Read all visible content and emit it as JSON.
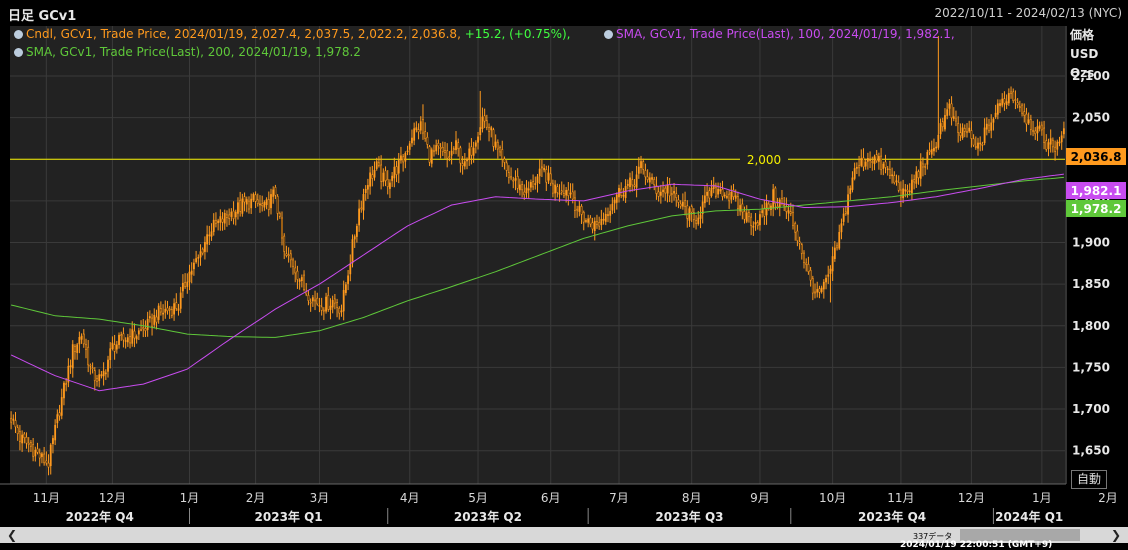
{
  "header": {
    "title": "日足 GCv1",
    "date_range": "2022/10/11 - 2024/02/13 (NYC)"
  },
  "legend": {
    "candle_text": "Cndl, GCv1, Trade Price, 2024/01/19, 2,027.4, 2,037.5, 2,022.2, 2,036.8,",
    "change_text": "+15.2, (+0.75%),",
    "sma100_text": "SMA, GCv1, Trade Price(Last),  100, 2024/01/19, 1,982.1,",
    "sma200_text": "SMA, GCv1, Trade Price(Last),  200, 2024/01/19, 1,978.2"
  },
  "axis_unit": {
    "line1": "価格",
    "line2": "USD",
    "line3": "Ozs"
  },
  "auto_button": "自動",
  "status": {
    "count": "337データ",
    "timestamp": "2024/01/19 22:00:51 (GMT+9)"
  },
  "colors": {
    "candle": "#ff9a1e",
    "sma100": "#c84cf0",
    "sma200": "#5fc83a",
    "reference": "#f5f000",
    "grid": "#3a3a3a",
    "background": "#222222",
    "change": "#40ff40"
  },
  "icons": {
    "scroll_left": "scroll-left-icon",
    "scroll_right": "scroll-right-icon",
    "legend_dot": "legend-dot-icon"
  },
  "chart_data": {
    "type": "candlestick",
    "title": "日足 GCv1",
    "ylim": [
      1610,
      2160
    ],
    "y_ticks": [
      "1,650",
      "1,700",
      "1,750",
      "1,800",
      "1,850",
      "1,900",
      "1,950",
      "2,000",
      "2,050",
      "2,100"
    ],
    "y_tick_values": [
      1650,
      1700,
      1750,
      1800,
      1850,
      1900,
      1950,
      2000,
      2050,
      2100
    ],
    "x_month_ticks": [
      "11月",
      "12月",
      "1月",
      "2月",
      "3月",
      "4月",
      "5月",
      "6月",
      "7月",
      "8月",
      "9月",
      "10月",
      "11月",
      "12月",
      "1月",
      "2月"
    ],
    "x_quarter_labels": [
      "2022年 Q4",
      "2023年 Q1",
      "2023年 Q2",
      "2023年 Q3",
      "2023年 Q4",
      "2024年 Q1"
    ],
    "reference_line": {
      "value": 2000,
      "label": "2,000"
    },
    "last_price_labels": [
      {
        "text": "2,036.8",
        "value": 2036.8,
        "series": "candle"
      },
      {
        "text": "1,982.1",
        "value": 1982.1,
        "series": "sma100"
      },
      {
        "text": "1,978.2",
        "value": 1978.2,
        "series": "sma200"
      }
    ],
    "candle_anchor_points": [
      [
        0,
        1690
      ],
      [
        4,
        1665
      ],
      [
        9,
        1655
      ],
      [
        14,
        1640
      ],
      [
        17,
        1635
      ],
      [
        22,
        1700
      ],
      [
        28,
        1770
      ],
      [
        32,
        1790
      ],
      [
        37,
        1740
      ],
      [
        41,
        1735
      ],
      [
        46,
        1775
      ],
      [
        52,
        1785
      ],
      [
        57,
        1790
      ],
      [
        62,
        1800
      ],
      [
        67,
        1815
      ],
      [
        72,
        1820
      ],
      [
        76,
        1825
      ],
      [
        80,
        1860
      ],
      [
        85,
        1880
      ],
      [
        90,
        1915
      ],
      [
        95,
        1925
      ],
      [
        100,
        1935
      ],
      [
        105,
        1945
      ],
      [
        110,
        1950
      ],
      [
        115,
        1940
      ],
      [
        120,
        1960
      ],
      [
        124,
        1885
      ],
      [
        128,
        1875
      ],
      [
        133,
        1845
      ],
      [
        138,
        1830
      ],
      [
        142,
        1825
      ],
      [
        146,
        1830
      ],
      [
        150,
        1820
      ],
      [
        154,
        1880
      ],
      [
        158,
        1940
      ],
      [
        162,
        1975
      ],
      [
        166,
        1990
      ],
      [
        170,
        1970
      ],
      [
        174,
        1985
      ],
      [
        178,
        2000
      ],
      [
        182,
        2030
      ],
      [
        186,
        2040
      ],
      [
        190,
        2005
      ],
      [
        194,
        2010
      ],
      [
        198,
        2000
      ],
      [
        202,
        2015
      ],
      [
        206,
        1990
      ],
      [
        210,
        2020
      ],
      [
        214,
        2050
      ],
      [
        218,
        2030
      ],
      [
        222,
        2000
      ],
      [
        226,
        1980
      ],
      [
        230,
        1970
      ],
      [
        234,
        1960
      ],
      [
        238,
        1975
      ],
      [
        242,
        1985
      ],
      [
        246,
        1965
      ],
      [
        250,
        1965
      ],
      [
        254,
        1960
      ],
      [
        258,
        1935
      ],
      [
        262,
        1925
      ],
      [
        266,
        1920
      ],
      [
        270,
        1935
      ],
      [
        274,
        1955
      ],
      [
        278,
        1965
      ],
      [
        282,
        1970
      ],
      [
        286,
        1990
      ],
      [
        290,
        1975
      ],
      [
        294,
        1960
      ],
      [
        298,
        1965
      ],
      [
        302,
        1950
      ],
      [
        306,
        1940
      ],
      [
        310,
        1925
      ],
      [
        314,
        1945
      ],
      [
        318,
        1960
      ],
      [
        322,
        1965
      ],
      [
        326,
        1955
      ],
      [
        330,
        1945
      ],
      [
        334,
        1930
      ],
      [
        338,
        1925
      ],
      [
        342,
        1935
      ],
      [
        346,
        1955
      ],
      [
        350,
        1945
      ],
      [
        354,
        1930
      ],
      [
        358,
        1900
      ],
      [
        362,
        1860
      ],
      [
        366,
        1835
      ],
      [
        370,
        1850
      ],
      [
        374,
        1885
      ],
      [
        378,
        1930
      ],
      [
        382,
        1980
      ],
      [
        386,
        1995
      ],
      [
        390,
        2005
      ],
      [
        394,
        1995
      ],
      [
        398,
        1985
      ],
      [
        402,
        1970
      ],
      [
        406,
        1955
      ],
      [
        410,
        1975
      ],
      [
        414,
        1995
      ],
      [
        418,
        2005
      ],
      [
        422,
        2040
      ],
      [
        426,
        2060
      ],
      [
        430,
        2030
      ],
      [
        434,
        2035
      ],
      [
        438,
        2010
      ],
      [
        442,
        2030
      ],
      [
        446,
        2050
      ],
      [
        450,
        2070
      ],
      [
        454,
        2080
      ],
      [
        458,
        2065
      ],
      [
        462,
        2045
      ],
      [
        466,
        2035
      ],
      [
        470,
        2020
      ],
      [
        474,
        2015
      ],
      [
        478,
        2036.8
      ]
    ],
    "sma100_points": [
      [
        0,
        1765
      ],
      [
        20,
        1740
      ],
      [
        40,
        1722
      ],
      [
        60,
        1730
      ],
      [
        80,
        1748
      ],
      [
        100,
        1785
      ],
      [
        120,
        1820
      ],
      [
        140,
        1850
      ],
      [
        160,
        1885
      ],
      [
        180,
        1920
      ],
      [
        200,
        1945
      ],
      [
        220,
        1955
      ],
      [
        240,
        1952
      ],
      [
        260,
        1950
      ],
      [
        280,
        1962
      ],
      [
        300,
        1970
      ],
      [
        320,
        1968
      ],
      [
        340,
        1952
      ],
      [
        360,
        1942
      ],
      [
        380,
        1943
      ],
      [
        400,
        1948
      ],
      [
        420,
        1955
      ],
      [
        440,
        1965
      ],
      [
        460,
        1976
      ],
      [
        478,
        1982.1
      ]
    ],
    "sma200_points": [
      [
        0,
        1825
      ],
      [
        20,
        1812
      ],
      [
        40,
        1808
      ],
      [
        60,
        1800
      ],
      [
        80,
        1790
      ],
      [
        100,
        1787
      ],
      [
        120,
        1786
      ],
      [
        140,
        1794
      ],
      [
        160,
        1810
      ],
      [
        180,
        1830
      ],
      [
        200,
        1847
      ],
      [
        220,
        1865
      ],
      [
        240,
        1885
      ],
      [
        260,
        1905
      ],
      [
        280,
        1920
      ],
      [
        300,
        1932
      ],
      [
        320,
        1938
      ],
      [
        340,
        1940
      ],
      [
        360,
        1945
      ],
      [
        380,
        1950
      ],
      [
        400,
        1955
      ],
      [
        420,
        1962
      ],
      [
        440,
        1968
      ],
      [
        460,
        1974
      ],
      [
        478,
        1978.2
      ]
    ]
  }
}
